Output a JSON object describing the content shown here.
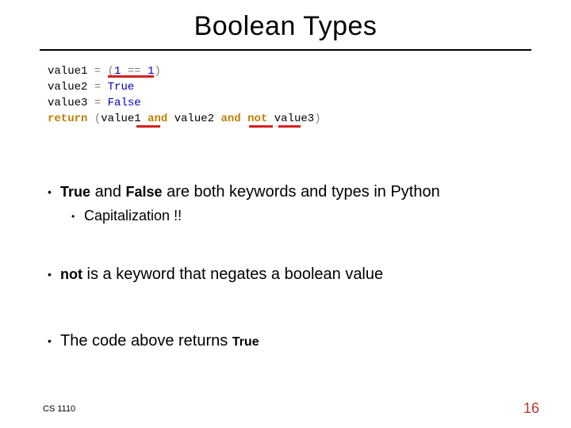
{
  "title": "Boolean Types",
  "code": {
    "l1_var": "value1",
    "l1_op": "=",
    "l1_op2": "(",
    "l1_num1": "1",
    "l1_eq": "==",
    "l1_num2": "1",
    "l1_close": ")",
    "l2_var": "value2",
    "l2_op": "=",
    "l2_val": "True",
    "l3_var": "value3",
    "l3_op": "=",
    "l3_val": "False",
    "l4_ret": "return",
    "l4_open": "(",
    "l4_v1": "value1",
    "l4_and1": "and",
    "l4_v2": "value2",
    "l4_and2": "and",
    "l4_not": "not",
    "l4_v3": "value3",
    "l4_close": ")"
  },
  "bullets": {
    "b1_code1": "True",
    "b1_mid": " and ",
    "b1_code2": "False",
    "b1_rest": " are both keywords and types in Python",
    "b1_sub": "Capitalization !!",
    "b2_code": "not",
    "b2_rest": " is a keyword that negates a boolean value",
    "b3_pre": "The code above returns ",
    "b3_code": "True"
  },
  "footer": {
    "course": "CS 1110",
    "page": "16"
  }
}
